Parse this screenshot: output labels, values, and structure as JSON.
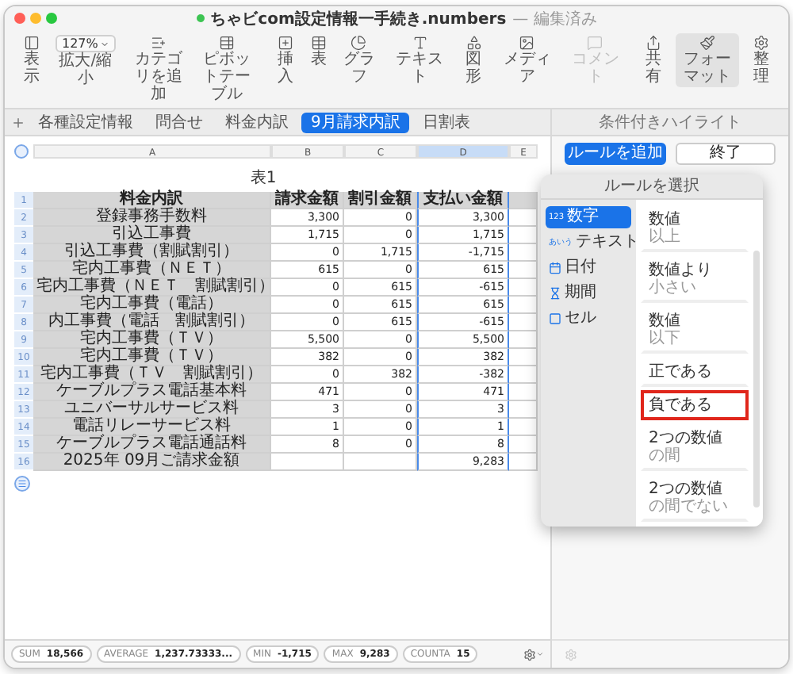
{
  "window": {
    "title": "ちゃビcom設定情報一手続き.numbers",
    "status": "— 編集済み"
  },
  "toolbar": {
    "zoom": "127%",
    "items": [
      {
        "kind": "tool",
        "label": "表示",
        "active": false,
        "disabled": false
      },
      {
        "kind": "zoom",
        "label": "拡大/縮小",
        "active": false,
        "disabled": false
      },
      {
        "kind": "tool",
        "label": "カテゴリを追加",
        "active": false,
        "disabled": false
      },
      {
        "kind": "tool",
        "label": "ピボットテーブル",
        "active": false,
        "disabled": false
      },
      {
        "kind": "tool",
        "label": "挿入",
        "active": false,
        "disabled": false
      },
      {
        "kind": "tool",
        "label": "表",
        "active": false,
        "disabled": false
      },
      {
        "kind": "tool",
        "label": "グラフ",
        "active": false,
        "disabled": false
      },
      {
        "kind": "tool",
        "label": "テキスト",
        "active": false,
        "disabled": false
      },
      {
        "kind": "tool",
        "label": "図形",
        "active": false,
        "disabled": false
      },
      {
        "kind": "tool",
        "label": "メディア",
        "active": false,
        "disabled": false
      },
      {
        "kind": "tool",
        "label": "コメント",
        "active": false,
        "disabled": true
      },
      {
        "kind": "tool",
        "label": "共有",
        "active": false,
        "disabled": false
      },
      {
        "kind": "tool",
        "label": "フォーマット",
        "active": true,
        "disabled": false
      },
      {
        "kind": "tool",
        "label": "整理",
        "active": false,
        "disabled": false
      }
    ]
  },
  "sheet_tabs": [
    {
      "label": "各種設定情報",
      "selected": false
    },
    {
      "label": "問合せ",
      "selected": false
    },
    {
      "label": "料金内訳",
      "selected": false
    },
    {
      "label": "9月請求内訳",
      "selected": true
    },
    {
      "label": "日割表",
      "selected": false
    }
  ],
  "table": {
    "title": "表1",
    "columns": [
      {
        "letter": "A",
        "selected": false
      },
      {
        "letter": "B",
        "selected": false
      },
      {
        "letter": "C",
        "selected": false
      },
      {
        "letter": "D",
        "selected": true
      },
      {
        "letter": "E",
        "selected": false
      }
    ],
    "rows": [
      {
        "number": "1",
        "cells": [
          "料金内訳",
          "請求金額",
          "割引金額",
          "支払い金額"
        ]
      },
      {
        "number": "2",
        "cells": [
          "登録事務手数料",
          "3,300",
          "0",
          "3,300"
        ]
      },
      {
        "number": "3",
        "cells": [
          "引込工事費",
          "1,715",
          "0",
          "1,715"
        ]
      },
      {
        "number": "4",
        "cells": [
          "引込工事費（割賦割引）",
          "0",
          "1,715",
          "-1,715"
        ]
      },
      {
        "number": "5",
        "cells": [
          "宅内工事費（ＮＥＴ）",
          "615",
          "0",
          "615"
        ]
      },
      {
        "number": "6",
        "cells": [
          "宅内工事費（ＮＥＴ　割賦割引）",
          "0",
          "615",
          "-615"
        ]
      },
      {
        "number": "7",
        "cells": [
          "宅内工事費（電話）",
          "0",
          "615",
          "615"
        ]
      },
      {
        "number": "8",
        "cells": [
          "内工事費（電話　割賦割引）",
          "0",
          "615",
          "-615"
        ]
      },
      {
        "number": "9",
        "cells": [
          "宅内工事費（ＴＶ）",
          "5,500",
          "0",
          "5,500"
        ]
      },
      {
        "number": "10",
        "cells": [
          "宅内工事費（ＴＶ）",
          "382",
          "0",
          "382"
        ]
      },
      {
        "number": "11",
        "cells": [
          "宅内工事費（ＴＶ　割賦割引）",
          "0",
          "382",
          "-382"
        ]
      },
      {
        "number": "12",
        "cells": [
          "ケーブルプラス電話基本料",
          "471",
          "0",
          "471"
        ]
      },
      {
        "number": "13",
        "cells": [
          "ユニバーサルサービス料",
          "3",
          "0",
          "3"
        ]
      },
      {
        "number": "14",
        "cells": [
          "電話リレーサービス料",
          "1",
          "0",
          "1"
        ]
      },
      {
        "number": "15",
        "cells": [
          "ケーブルプラス電話通話料",
          "8",
          "0",
          "8"
        ]
      },
      {
        "number": "16",
        "cells": [
          "2025年 09月ご請求金額",
          null,
          null,
          "9,283"
        ]
      }
    ]
  },
  "status_bar": [
    {
      "label": "SUM",
      "value": "18,566"
    },
    {
      "label": "AVERAGE",
      "value": "1,237.73333..."
    },
    {
      "label": "MIN",
      "value": "-1,715"
    },
    {
      "label": "MAX",
      "value": "9,283"
    },
    {
      "label": "COUNTA",
      "value": "15"
    }
  ],
  "panel": {
    "title": "条件付きハイライト",
    "buttons": [
      {
        "label": "ルールを追加",
        "primary": true
      },
      {
        "label": "終了",
        "primary": false
      }
    ]
  },
  "popover": {
    "title": "ルールを選択",
    "categories": [
      {
        "badge": "123",
        "label": "数字",
        "selected": true
      },
      {
        "badge": "あいう",
        "label": "テキスト",
        "selected": false
      },
      {
        "label": "日付",
        "selected": false
      },
      {
        "label": "期間",
        "selected": false
      },
      {
        "label": "セル",
        "selected": false
      }
    ],
    "rules": [
      {
        "title": "数値",
        "subtitle": "以上",
        "highlighted": false
      },
      {
        "title": "数値より",
        "subtitle": "小さい",
        "highlighted": false
      },
      {
        "title": "数値",
        "subtitle": "以下",
        "highlighted": false
      },
      {
        "title": "正である",
        "highlighted": false
      },
      {
        "title": "負である",
        "highlighted": true
      },
      {
        "title": "2つの数値",
        "subtitle": "の間",
        "highlighted": false
      },
      {
        "title": "2つの数値",
        "subtitle": "の間でない",
        "highlighted": false
      }
    ]
  }
}
